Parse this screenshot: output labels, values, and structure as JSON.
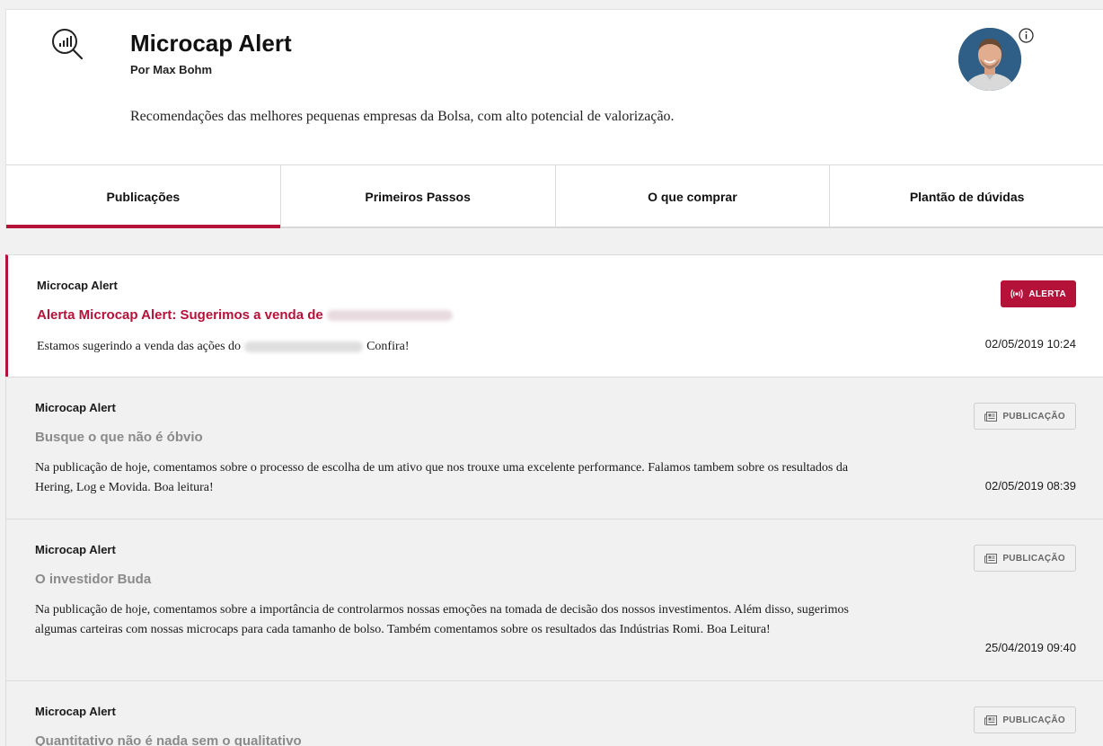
{
  "header": {
    "title": "Microcap Alert",
    "author": "Por Max Bohm",
    "description": "Recomendações das melhores pequenas empresas da Bolsa, com alto potencial de valorização."
  },
  "tabs": [
    {
      "label": "Publicações",
      "active": true
    },
    {
      "label": "Primeiros Passos",
      "active": false
    },
    {
      "label": "O que comprar",
      "active": false
    },
    {
      "label": "Plantão de dúvidas",
      "active": false
    }
  ],
  "posts": [
    {
      "source": "Microcap Alert",
      "title": "Alerta Microcap Alert: Sugerimos a venda de",
      "body_prefix": "Estamos sugerindo a venda das ações do",
      "body_suffix": "Confira!",
      "badge": "ALERTA",
      "date": "02/05/2019 10:24"
    },
    {
      "source": "Microcap Alert",
      "title": "Busque o que não é óbvio",
      "body": "Na publicação de hoje, comentamos sobre o processo de escolha de um ativo que nos trouxe uma excelente performance. Falamos tambem sobre os resultados da Hering, Log e Movida. Boa leitura!",
      "badge": "PUBLICAÇÃO",
      "date": "02/05/2019 08:39"
    },
    {
      "source": "Microcap Alert",
      "title": "O investidor Buda",
      "body": "Na publicação de hoje, comentamos sobre a importância de controlarmos nossas emoções na tomada de decisão dos nossos investimentos. Além disso, sugerimos algumas carteiras com nossas microcaps para cada tamanho de bolso. Também comentamos sobre os resultados das Indústrias Romi. Boa Leitura!",
      "badge": "PUBLICAÇÃO",
      "date": "25/04/2019 09:40"
    },
    {
      "source": "Microcap Alert",
      "title": "Quantitativo não é nada sem o qualitativo",
      "badge": "PUBLICAÇÃO"
    }
  ]
}
